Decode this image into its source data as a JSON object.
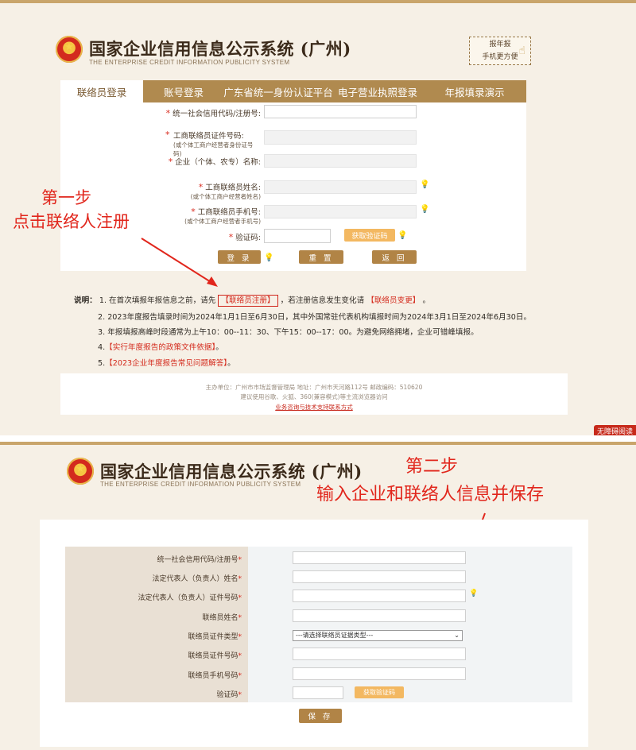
{
  "header": {
    "title_cn": "国家企业信用信息公示系统 (广州)",
    "title_en": "THE ENTERPRISE CREDIT INFORMATION PUBLICITY SYSTEM",
    "mobile_line1": "报年报",
    "mobile_line2": "手机更方便"
  },
  "tabs": [
    {
      "label": "联络员登录",
      "active": true
    },
    {
      "label": "账号登录",
      "active": false
    },
    {
      "label": "广东省统一身份认证平台",
      "active": false
    },
    {
      "label": "电子营业执照登录",
      "active": false
    },
    {
      "label": "年报填录演示",
      "active": false
    }
  ],
  "login_form": {
    "required_mark": "*",
    "f1": {
      "label": "统一社会信用代码/注册号:"
    },
    "f2": {
      "label": "工商联络员证件号码:",
      "sub": "(或个体工商户经营者身份证号码)"
    },
    "f3": {
      "label": "企业（个体、农专）名称:"
    },
    "f4": {
      "label": "工商联络员姓名:",
      "sub": "(或个体工商户经营者姓名)"
    },
    "f5": {
      "label": "工商联络员手机号:",
      "sub": "(或个体工商户经营者手机号)"
    },
    "f6": {
      "label": "验证码:"
    },
    "get_code": "获取验证码",
    "login_btn": "登 录",
    "reset_btn": "重 置",
    "back_btn": "返 回"
  },
  "annotation1": {
    "line1": "第一步",
    "line2": "点击联络人注册"
  },
  "annotation2": {
    "line1": "第二步",
    "line2": "输入企业和联络人信息并保存"
  },
  "notes": {
    "label": "说明：",
    "n1_pre": "1. 在首次填报年报信息之前，请先",
    "n1_link1": "【联络员注册】",
    "n1_mid": "，若注册信息发生变化请",
    "n1_link2": "【联络员变更】",
    "n1_end": "。",
    "n2": "2. 2023年度报告填录时间为2024年1月1日至6月30日，其中外国常驻代表机构填报时间为2024年3月1日至2024年6月30日。",
    "n3": "3. 年报填报高峰时段通常为上午10：00--11：30、下午15：00--17：00。为避免网络拥堵，企业可错峰填报。",
    "n4_num": "4.",
    "n4_link": "【实行年度报告的政策文件依据】",
    "n4_end": "。",
    "n5_num": "5.",
    "n5_link": "【2023企业年度报告常见问题解答】",
    "n5_end": "。"
  },
  "footer": {
    "line1": "主办单位：广州市市场监督管理局    地址：广州市天河路112号    邮政编码：510620",
    "line2": "建议使用谷歌、火狐、360(兼容模式)等主流浏览器访问",
    "line3": "业务咨询与技术支持联系方式"
  },
  "corner_tag": "无障碍阅读",
  "register_form": {
    "r1": "统一社会信用代码/注册号",
    "r2": "法定代表人（负责人）姓名",
    "r3": "法定代表人（负责人）证件号码",
    "r4": "联络员姓名",
    "r5": "联络员证件类型",
    "r6": "联络员证件号码",
    "r7": "联络员手机号码",
    "r8": "验证码",
    "star": "*",
    "select_placeholder": "---请选择联络员证据类型---",
    "get_code": "获取验证码",
    "save_btn": "保 存"
  },
  "colors": {
    "tab_bar": "#b08a4f",
    "accent_red": "#e1261c",
    "button_brown": "#b18446",
    "button_orange": "#f3b861"
  }
}
